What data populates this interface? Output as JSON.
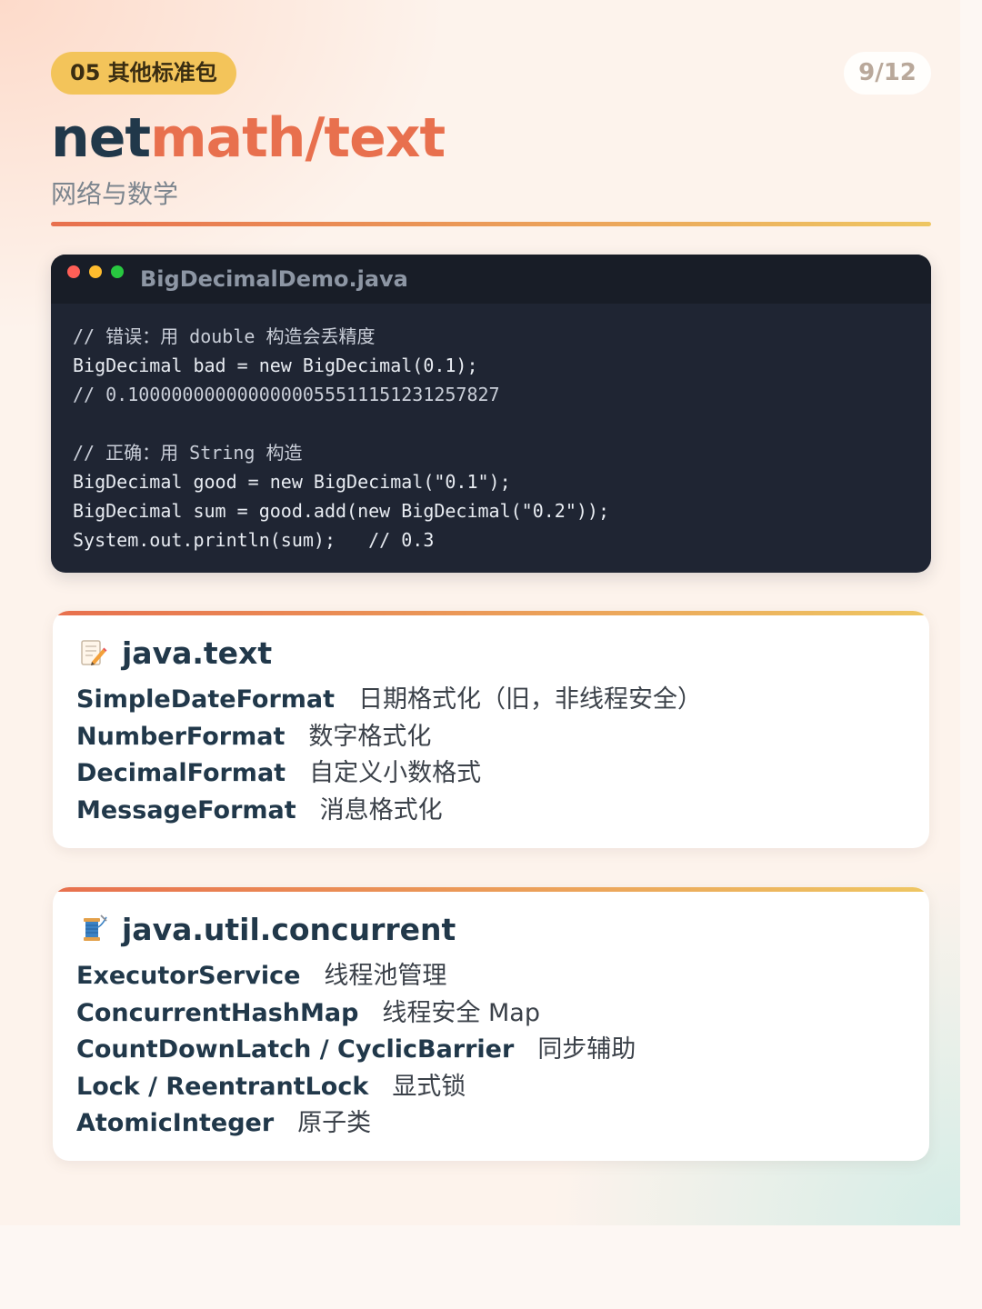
{
  "header": {
    "badge": "05 其他标准包",
    "pager": "9/12",
    "title_part1": "net",
    "title_part2": "math/text",
    "subtitle": "网络与数学"
  },
  "code": {
    "filename": "BigDecimalDemo.java",
    "lines": [
      "// 错误：用 double 构造会丢精度",
      "BigDecimal bad = new BigDecimal(0.1);",
      "// 0.1000000000000000055511151231257827",
      "",
      "// 正确：用 String 构造",
      "BigDecimal good = new BigDecimal(\"0.1\");",
      "BigDecimal sum = good.add(new BigDecimal(\"0.2\"));",
      "System.out.println(sum);   // 0.3"
    ]
  },
  "cards": [
    {
      "title": "java.text",
      "icon": "memo-pencil-icon",
      "items": [
        {
          "name": "SimpleDateFormat",
          "desc": "日期格式化（旧，非线程安全）"
        },
        {
          "name": "NumberFormat",
          "desc": "数字格式化"
        },
        {
          "name": "DecimalFormat",
          "desc": "自定义小数格式"
        },
        {
          "name": "MessageFormat",
          "desc": "消息格式化"
        }
      ]
    },
    {
      "title": "java.util.concurrent",
      "icon": "thread-spool-icon",
      "items": [
        {
          "name": "ExecutorService",
          "desc": "线程池管理"
        },
        {
          "name": "ConcurrentHashMap",
          "desc": "线程安全 Map"
        },
        {
          "name": "CountDownLatch / CyclicBarrier",
          "desc": "同步辅助"
        },
        {
          "name": "Lock / ReentrantLock",
          "desc": "显式锁"
        },
        {
          "name": "AtomicInteger",
          "desc": "原子类"
        }
      ]
    }
  ],
  "colors": {
    "accent": "#e8704e",
    "navy": "#21384a",
    "badge": "#f3c45a",
    "code_bg": "#1f2533"
  }
}
